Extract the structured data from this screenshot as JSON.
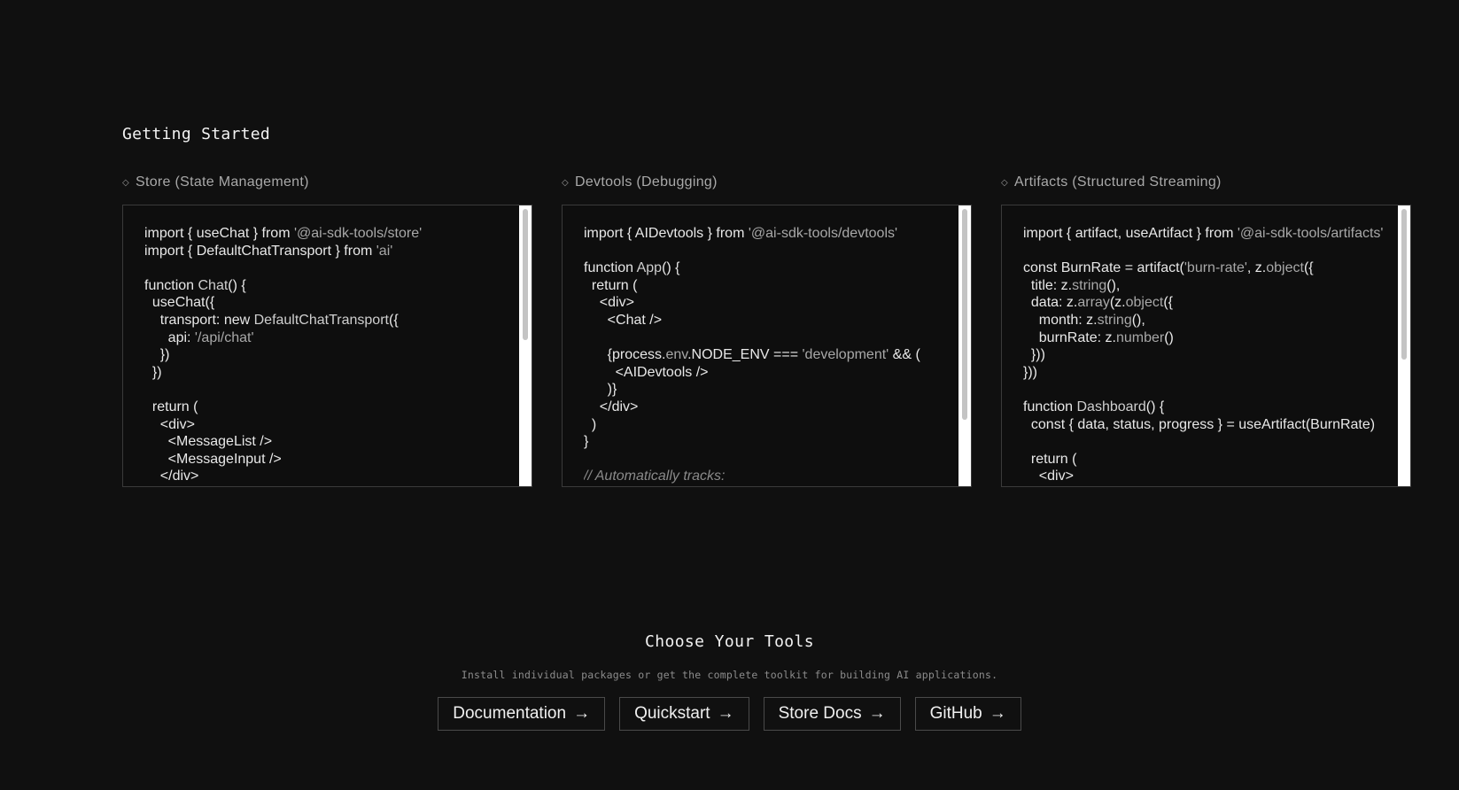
{
  "getting_started": {
    "title": "Getting Started",
    "columns": [
      {
        "name": "store",
        "icon": "diamond-icon",
        "header": "Store (State Management)",
        "code_lines": [
          [
            [
              "t",
              "import { useChat } from "
            ],
            [
              "s",
              "'@ai-sdk-tools/store'"
            ]
          ],
          [
            [
              "t",
              "import { DefaultChatTransport } from "
            ],
            [
              "s",
              "'ai'"
            ]
          ],
          [
            [
              "t",
              ""
            ]
          ],
          [
            [
              "t",
              "function "
            ],
            [
              "f",
              "Chat"
            ],
            [
              "t",
              "() {"
            ]
          ],
          [
            [
              "t",
              "  useChat({"
            ]
          ],
          [
            [
              "t",
              "    transport: new "
            ],
            [
              "f",
              "DefaultChatTransport"
            ],
            [
              "t",
              "({"
            ]
          ],
          [
            [
              "t",
              "      api: "
            ],
            [
              "s",
              "'/api/chat'"
            ]
          ],
          [
            [
              "t",
              "    })"
            ]
          ],
          [
            [
              "t",
              "  })"
            ]
          ],
          [
            [
              "t",
              ""
            ]
          ],
          [
            [
              "t",
              "  return ("
            ]
          ],
          [
            [
              "t",
              "    <div>"
            ]
          ],
          [
            [
              "t",
              "      <MessageList />"
            ]
          ],
          [
            [
              "t",
              "      <MessageInput />"
            ]
          ],
          [
            [
              "t",
              "    </div>"
            ]
          ]
        ]
      },
      {
        "name": "devtools",
        "icon": "diamond-icon",
        "header": "Devtools (Debugging)",
        "code_lines": [
          [
            [
              "t",
              "import { AIDevtools } from "
            ],
            [
              "s",
              "'@ai-sdk-tools/devtools'"
            ]
          ],
          [
            [
              "t",
              ""
            ]
          ],
          [
            [
              "t",
              "function "
            ],
            [
              "f",
              "App"
            ],
            [
              "t",
              "() {"
            ]
          ],
          [
            [
              "t",
              "  return ("
            ]
          ],
          [
            [
              "t",
              "    <div>"
            ]
          ],
          [
            [
              "t",
              "      <Chat />"
            ]
          ],
          [
            [
              "t",
              ""
            ]
          ],
          [
            [
              "t",
              "      {process."
            ],
            [
              "s",
              "env"
            ],
            [
              "t",
              ".NODE_ENV === "
            ],
            [
              "s",
              "'development'"
            ],
            [
              "t",
              " && ("
            ]
          ],
          [
            [
              "t",
              "        <AIDevtools />"
            ]
          ],
          [
            [
              "t",
              "      )}"
            ]
          ],
          [
            [
              "t",
              "    </div>"
            ]
          ],
          [
            [
              "t",
              "  )"
            ]
          ],
          [
            [
              "t",
              "}"
            ]
          ],
          [
            [
              "t",
              ""
            ]
          ],
          [
            [
              "c",
              "// Automatically tracks:"
            ]
          ]
        ]
      },
      {
        "name": "artifacts",
        "icon": "diamond-icon",
        "header": "Artifacts (Structured Streaming)",
        "code_lines": [
          [
            [
              "t",
              "import { artifact, useArtifact } from "
            ],
            [
              "s",
              "'@ai-sdk-tools/artifacts'"
            ]
          ],
          [
            [
              "t",
              ""
            ]
          ],
          [
            [
              "t",
              "const BurnRate = artifact("
            ],
            [
              "s",
              "'burn-rate'"
            ],
            [
              "t",
              ", z."
            ],
            [
              "s",
              "object"
            ],
            [
              "t",
              "({"
            ]
          ],
          [
            [
              "t",
              "  title: z."
            ],
            [
              "s",
              "string"
            ],
            [
              "t",
              "(),"
            ]
          ],
          [
            [
              "t",
              "  data: z."
            ],
            [
              "s",
              "array"
            ],
            [
              "t",
              "(z."
            ],
            [
              "s",
              "object"
            ],
            [
              "t",
              "({"
            ]
          ],
          [
            [
              "t",
              "    month: z."
            ],
            [
              "s",
              "string"
            ],
            [
              "t",
              "(),"
            ]
          ],
          [
            [
              "t",
              "    burnRate: z."
            ],
            [
              "s",
              "number"
            ],
            [
              "t",
              "()"
            ]
          ],
          [
            [
              "t",
              "  }))"
            ]
          ],
          [
            [
              "t",
              "}))"
            ]
          ],
          [
            [
              "t",
              ""
            ]
          ],
          [
            [
              "t",
              "function "
            ],
            [
              "f",
              "Dashboard"
            ],
            [
              "t",
              "() {"
            ]
          ],
          [
            [
              "t",
              "  const { data, status, progress } = useArtifact(BurnRate)"
            ]
          ],
          [
            [
              "t",
              ""
            ]
          ],
          [
            [
              "t",
              "  return ("
            ]
          ],
          [
            [
              "t",
              "    <div>"
            ]
          ]
        ]
      }
    ]
  },
  "tools": {
    "title": "Choose Your Tools",
    "subtitle": "Install individual packages or get the complete toolkit for building AI applications.",
    "buttons": [
      {
        "label": "Documentation",
        "arrow": "→",
        "name": "documentation-button"
      },
      {
        "label": "Quickstart",
        "arrow": "→",
        "name": "quickstart-button"
      },
      {
        "label": "Store Docs",
        "arrow": "→",
        "name": "store-docs-button"
      },
      {
        "label": "GitHub",
        "arrow": "→",
        "name": "github-button"
      }
    ]
  }
}
